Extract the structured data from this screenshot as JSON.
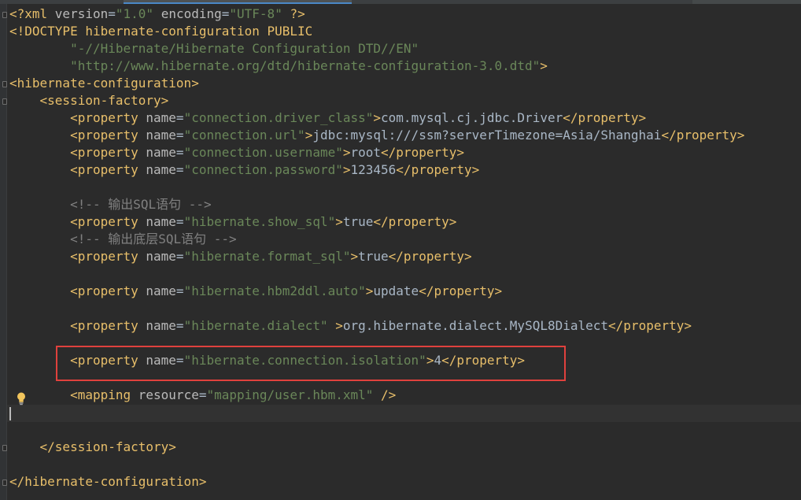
{
  "editor": {
    "lines": [
      [
        [
          "t",
          "<?xml "
        ],
        [
          "a",
          "version"
        ],
        [
          "x",
          "="
        ],
        [
          "v",
          "\"1.0\""
        ],
        [
          "x",
          " "
        ],
        [
          "a",
          "encoding"
        ],
        [
          "x",
          "="
        ],
        [
          "v",
          "\"UTF-8\""
        ],
        [
          "x",
          " "
        ],
        [
          "t",
          "?>"
        ]
      ],
      [
        [
          "t",
          "<!DOCTYPE hibernate-configuration PUBLIC"
        ]
      ],
      [
        [
          "x",
          "        "
        ],
        [
          "v",
          "\"-//Hibernate/Hibernate Configuration DTD//EN\""
        ]
      ],
      [
        [
          "x",
          "        "
        ],
        [
          "v",
          "\"http://www.hibernate.org/dtd/hibernate-configuration-3.0.dtd\""
        ],
        [
          "t",
          ">"
        ]
      ],
      [
        [
          "t",
          "<hibernate-configuration>"
        ]
      ],
      [
        [
          "x",
          "    "
        ],
        [
          "t",
          "<session-factory>"
        ]
      ],
      [
        [
          "x",
          "        "
        ],
        [
          "t",
          "<property "
        ],
        [
          "a",
          "name"
        ],
        [
          "x",
          "="
        ],
        [
          "v",
          "\"connection.driver_class\""
        ],
        [
          "t",
          ">"
        ],
        [
          "x",
          "com.mysql.cj.jdbc.Driver"
        ],
        [
          "t",
          "</property>"
        ]
      ],
      [
        [
          "x",
          "        "
        ],
        [
          "t",
          "<property "
        ],
        [
          "a",
          "name"
        ],
        [
          "x",
          "="
        ],
        [
          "v",
          "\"connection.url\""
        ],
        [
          "t",
          ">"
        ],
        [
          "x",
          "jdbc:mysql:///ssm?serverTimezone=Asia/Shanghai"
        ],
        [
          "t",
          "</property>"
        ]
      ],
      [
        [
          "x",
          "        "
        ],
        [
          "t",
          "<property "
        ],
        [
          "a",
          "name"
        ],
        [
          "x",
          "="
        ],
        [
          "v",
          "\"connection.username\""
        ],
        [
          "t",
          ">"
        ],
        [
          "x",
          "root"
        ],
        [
          "t",
          "</property>"
        ]
      ],
      [
        [
          "x",
          "        "
        ],
        [
          "t",
          "<property "
        ],
        [
          "a",
          "name"
        ],
        [
          "x",
          "="
        ],
        [
          "v",
          "\"connection.password\""
        ],
        [
          "t",
          ">"
        ],
        [
          "x",
          "123456"
        ],
        [
          "t",
          "</property>"
        ]
      ],
      [],
      [
        [
          "x",
          "        "
        ],
        [
          "c",
          "<!-- 输出SQL语句 -->"
        ]
      ],
      [
        [
          "x",
          "        "
        ],
        [
          "t",
          "<property "
        ],
        [
          "a",
          "name"
        ],
        [
          "x",
          "="
        ],
        [
          "v",
          "\"hibernate.show_sql\""
        ],
        [
          "t",
          ">"
        ],
        [
          "x",
          "true"
        ],
        [
          "t",
          "</property>"
        ]
      ],
      [
        [
          "x",
          "        "
        ],
        [
          "c",
          "<!-- 输出底层SQL语句 -->"
        ]
      ],
      [
        [
          "x",
          "        "
        ],
        [
          "t",
          "<property "
        ],
        [
          "a",
          "name"
        ],
        [
          "x",
          "="
        ],
        [
          "v",
          "\"hibernate.format_sql\""
        ],
        [
          "t",
          ">"
        ],
        [
          "x",
          "true"
        ],
        [
          "t",
          "</property>"
        ]
      ],
      [],
      [
        [
          "x",
          "        "
        ],
        [
          "t",
          "<property "
        ],
        [
          "a",
          "name"
        ],
        [
          "x",
          "="
        ],
        [
          "v",
          "\"hibernate.hbm2ddl.auto\""
        ],
        [
          "t",
          ">"
        ],
        [
          "x",
          "update"
        ],
        [
          "t",
          "</property>"
        ]
      ],
      [],
      [
        [
          "x",
          "        "
        ],
        [
          "t",
          "<property "
        ],
        [
          "a",
          "name"
        ],
        [
          "x",
          "="
        ],
        [
          "v",
          "\"hibernate.dialect\""
        ],
        [
          "x",
          " "
        ],
        [
          "t",
          ">"
        ],
        [
          "x",
          "org.hibernate.dialect.MySQL8Dialect"
        ],
        [
          "t",
          "</property>"
        ]
      ],
      [],
      [
        [
          "x",
          "        "
        ],
        [
          "t",
          "<property "
        ],
        [
          "a",
          "name"
        ],
        [
          "x",
          "="
        ],
        [
          "v",
          "\"hibernate.connection.isolation\""
        ],
        [
          "t",
          ">"
        ],
        [
          "x",
          "4"
        ],
        [
          "t",
          "</property>"
        ]
      ],
      [],
      [
        [
          "x",
          "        "
        ],
        [
          "t",
          "<mapping "
        ],
        [
          "a",
          "resource"
        ],
        [
          "x",
          "="
        ],
        [
          "v",
          "\"mapping/user.hbm.xml\""
        ],
        [
          "x",
          " "
        ],
        [
          "t",
          "/>"
        ]
      ],
      [],
      [],
      [
        [
          "x",
          "    "
        ],
        [
          "t",
          "</session-factory>"
        ]
      ],
      [],
      [
        [
          "t",
          "</hibernate-configuration>"
        ]
      ]
    ]
  },
  "colors": {
    "background": "#2b2b2b",
    "tag": "#e8bf6a",
    "attribute": "#bababa",
    "value": "#6a8759",
    "text": "#a9b7c6",
    "comment": "#808080",
    "highlight_border": "#e0413d"
  },
  "icons": {
    "intention": "lightbulb-icon",
    "fold": "fold-marker-icon"
  }
}
